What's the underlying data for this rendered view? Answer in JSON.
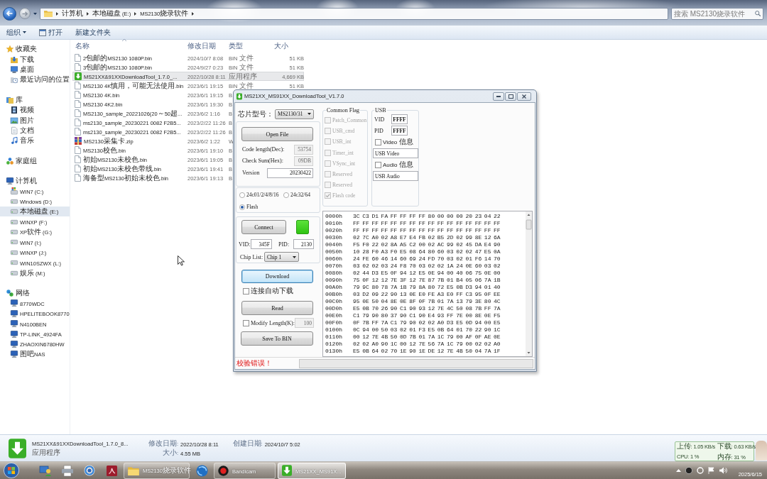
{
  "explorer": {
    "breadcrumbs": [
      {
        "label": "计算机"
      },
      {
        "label": "本地磁盘 (E:)"
      },
      {
        "label": "MS2130烧录软件"
      }
    ],
    "search": {
      "placeholder": "搜索 MS2130烧录软件"
    },
    "toolbar": [
      {
        "label": "组织",
        "kind": "menu"
      },
      {
        "label": "打开",
        "kind": "open"
      },
      {
        "label": "新建文件夹",
        "kind": "plain"
      }
    ],
    "sidebar": [
      {
        "label": "收藏夹",
        "kind": "favorites",
        "selected": false,
        "children": [
          {
            "label": "下载",
            "kind": "downloads",
            "selected": false
          },
          {
            "label": "桌面",
            "kind": "desktop",
            "selected": false
          },
          {
            "label": "最近访问的位置",
            "kind": "recent",
            "selected": false
          }
        ]
      },
      {
        "label": "库",
        "kind": "library",
        "selected": false,
        "children": [
          {
            "label": "视频",
            "kind": "video",
            "selected": false
          },
          {
            "label": "图片",
            "kind": "pictures",
            "selected": false
          },
          {
            "label": "文档",
            "kind": "documents",
            "selected": false
          },
          {
            "label": "音乐",
            "kind": "music",
            "selected": false
          }
        ]
      },
      {
        "label": "家庭组",
        "kind": "homegroup",
        "selected": false
      },
      {
        "label": "计算机",
        "kind": "computer",
        "selected": false,
        "children": [
          {
            "label": "WIN7 (C:)",
            "kind": "system-drive",
            "selected": false
          },
          {
            "label": "Windows (D:)",
            "kind": "drive",
            "selected": false
          },
          {
            "label": "本地磁盘 (E:)",
            "kind": "drive",
            "selected": true
          },
          {
            "label": "WINXP (F:)",
            "kind": "drive",
            "selected": false
          },
          {
            "label": "XP软件 (G:)",
            "kind": "drive",
            "selected": false
          },
          {
            "label": "WIN7 (I:)",
            "kind": "drive",
            "selected": false
          },
          {
            "label": "WINXP (J:)",
            "kind": "drive",
            "selected": false
          },
          {
            "label": "WIN10SZWX (L:)",
            "kind": "drive",
            "selected": false
          },
          {
            "label": "娱乐 (M:)",
            "kind": "drive",
            "selected": false
          }
        ]
      },
      {
        "label": "网络",
        "kind": "network",
        "selected": false,
        "children": [
          {
            "label": "8770WDC",
            "kind": "pc",
            "selected": false
          },
          {
            "label": "HPELITEBOOK8770",
            "kind": "pc",
            "selected": false
          },
          {
            "label": "N4100BEN",
            "kind": "pc",
            "selected": false
          },
          {
            "label": "TP-LINK_4924FA",
            "kind": "pc",
            "selected": false
          },
          {
            "label": "ZHAOXIN6780HW",
            "kind": "pc",
            "selected": false
          },
          {
            "label": "图吧NAS",
            "kind": "pc",
            "selected": false
          }
        ]
      }
    ],
    "columns": [
      "名称",
      "修改日期",
      "类型",
      "大小"
    ],
    "files": [
      {
        "name": "2包邮的MS2130 1080P.bin",
        "date": "2024/10/7 8:08",
        "type": "BIN 文件",
        "size": "51 KB",
        "kind": "bin",
        "selected": false
      },
      {
        "name": "3包邮的MS2130 1080P.bin",
        "date": "2024/9/27 0:23",
        "type": "BIN 文件",
        "size": "51 KB",
        "kind": "bin",
        "selected": false
      },
      {
        "name": "MS21XX&91XXDownloadTool_1.7.0_...",
        "date": "2022/10/28 8:11",
        "type": "应用程序",
        "size": "4,669 KB",
        "kind": "app",
        "selected": true
      },
      {
        "name": "MS2130 4K慎用，可能无法使用.bin",
        "date": "2023/6/1 19:15",
        "type": "BIN 文件",
        "size": "51 KB",
        "kind": "bin",
        "selected": false
      },
      {
        "name": "MS2130 4K.bin",
        "date": "2023/6/1 19:15",
        "type": "B",
        "kind": "bin",
        "selected": false
      },
      {
        "name": "MS2130 4K2.bin",
        "date": "2023/6/1 19:30",
        "type": "B",
        "kind": "bin",
        "selected": false
      },
      {
        "name": "MS2130_sample_20221026(20～50超...",
        "date": "2023/6/2 1:16",
        "type": "B",
        "kind": "bin",
        "selected": false
      },
      {
        "name": "ms2130_sample_20230221 0082 F2B5...",
        "date": "2023/2/22 11:26",
        "type": "B",
        "kind": "bin",
        "selected": false
      },
      {
        "name": "ms2130_sample_20230221 0082 F2B5...",
        "date": "2023/2/22 11:26",
        "type": "B",
        "kind": "bin",
        "selected": false
      },
      {
        "name": "MS2130采集卡.zip",
        "date": "2023/6/2 1:22",
        "type": "W",
        "kind": "zip",
        "selected": false
      },
      {
        "name": "MS2130校色.bin",
        "date": "2023/6/1 19:10",
        "type": "B",
        "kind": "bin",
        "selected": false
      },
      {
        "name": "初始MS2130未校色.bin",
        "date": "2023/6/1 19:05",
        "type": "B",
        "kind": "bin",
        "selected": false
      },
      {
        "name": "初始MS2130未校色带线.bin",
        "date": "2023/6/1 19:41",
        "type": "B",
        "kind": "bin",
        "selected": false
      },
      {
        "name": "海备型MS2130初始未校色.bin",
        "date": "2023/6/1 19:13",
        "type": "B",
        "kind": "bin",
        "selected": false
      }
    ],
    "details": {
      "name": "MS21XX&91XXDownloadTool_1.7.0_8...",
      "type": "应用程序",
      "fields": [
        {
          "label": "修改日期:",
          "value": "2022/10/28 8:11"
        },
        {
          "label": "大小:",
          "value": "4.55 MB"
        },
        {
          "label": "创建日期:",
          "value": "2024/10/7 5:02"
        }
      ]
    }
  },
  "tool_window": {
    "title": "MS21XX_MS91XX_DownloadTool_V1.7.0",
    "chip_model": {
      "label": "芯片型号：",
      "value": "MS2130/31"
    },
    "open_file_button": "Open File",
    "code_info": [
      {
        "label": "Code length(Dec):",
        "value": "53754",
        "disabled": true
      },
      {
        "label": "Check Sum(Hex):",
        "value": "09DB",
        "disabled": true
      },
      {
        "label": "Version",
        "value": "20230422",
        "disabled": false
      }
    ],
    "memory_type": [
      {
        "label": "24c01/2/4/8/16",
        "selected": false
      },
      {
        "label": "24c32/64",
        "selected": false
      },
      {
        "label": "Flash",
        "selected": true
      }
    ],
    "connect_button": "Connect",
    "connection": {
      "connected": true
    },
    "vid": {
      "label": "VID:",
      "value": "345F"
    },
    "pid": {
      "label": "PID:",
      "value": "2130"
    },
    "chip_list": {
      "label": "Chip List:",
      "value": "Chip 1"
    },
    "download_button": {
      "label": "Download",
      "focused": true
    },
    "auto_download": {
      "label": "连接自动下载",
      "checked": false
    },
    "read_button": "Read",
    "modify_length": {
      "label": "Modify Length(K):",
      "checked": false,
      "value": "100"
    },
    "save_button": "Save To BIN",
    "common_flag": {
      "title": "Common Flag",
      "flags": [
        {
          "label": "Patch_Common",
          "checked": false,
          "disabled": true
        },
        {
          "label": "USB_cmd",
          "checked": false,
          "disabled": true
        },
        {
          "label": "USB_int",
          "checked": false,
          "disabled": true
        },
        {
          "label": "Timer_int",
          "checked": false,
          "disabled": true
        },
        {
          "label": "VSync_int",
          "checked": false,
          "disabled": true
        },
        {
          "label": "Reserved",
          "checked": false,
          "disabled": true
        },
        {
          "label": "Reserved",
          "checked": false,
          "disabled": true
        },
        {
          "label": "Flash code",
          "checked": true,
          "disabled": true
        }
      ]
    },
    "usb": {
      "title": "USB",
      "vid": {
        "label": "VID",
        "value": "FFFF"
      },
      "pid": {
        "label": "PID",
        "value": "FFFF"
      },
      "video": {
        "label": "Video 信息",
        "checked": false,
        "value": "USB Video"
      },
      "audio": {
        "label": "Audio 信息",
        "checked": false,
        "value": "USB Audio"
      }
    },
    "hex_dump": [
      {
        "offset": "0000h",
        "bytes": "3C C3 D1 FA FF FF FF FF 80 00 00 00 20 23 04 22"
      },
      {
        "offset": "0010h",
        "bytes": "FF FF FF FF FF FF FF FF FF FF FF FF FF FF FF FF"
      },
      {
        "offset": "0020h",
        "bytes": "FF FF FF FF FF FF FF FF FF FF FF FF FF FF FF FF"
      },
      {
        "offset": "0030h",
        "bytes": "02 7C A0 02 A8 E7 E4 FB 02 B5 2D 02 99 8E 12 6A"
      },
      {
        "offset": "0040h",
        "bytes": "F5 F0 22 02 8A A5 C2 00 02 AC 99 02 45 DA E4 90"
      },
      {
        "offset": "0050h",
        "bytes": "10 28 F0 A3 F0 E5 08 64 80 60 03 02 02 47 E5 0A"
      },
      {
        "offset": "0060h",
        "bytes": "24 FE 60 46 14 60 69 24 FD 70 03 02 01 F6 14 70"
      },
      {
        "offset": "0070h",
        "bytes": "03 02 02 03 24 F8 70 03 02 02 1A 24 0E 60 03 02"
      },
      {
        "offset": "0080h",
        "bytes": "02 44 D3 E5 0F 94 12 E5 0E 94 00 40 06 75 0E 00"
      },
      {
        "offset": "0090h",
        "bytes": "75 0F 12 12 7E 3F 12 7E 87 7B 01 B4 05 06 7A 1B"
      },
      {
        "offset": "00A0h",
        "bytes": "79 9C 80 78 7A 1B 79 8A 80 72 E5 0B D3 94 01 40"
      },
      {
        "offset": "00B0h",
        "bytes": "03 D2 09 22 90 13 0E E0 FE A3 E0 FF C3 95 0F EE"
      },
      {
        "offset": "00C0h",
        "bytes": "95 0E 50 04 8E 0E 8F 0F 7B 01 7A 13 79 3E 80 4C"
      },
      {
        "offset": "00D0h",
        "bytes": "E5 0B 70 26 90 C1 90 93 12 7E 4C 50 08 7B FF 7A"
      },
      {
        "offset": "00E0h",
        "bytes": "C1 79 90 80 37 90 C1 90 E4 93 FF 7E 00 8E 0E F5"
      },
      {
        "offset": "00F0h",
        "bytes": "0F 7B FF 7A C1 79 90 02 02 A0 D3 E5 0D 94 00 E5"
      },
      {
        "offset": "0100h",
        "bytes": "0C 94 00 50 03 02 01 F3 E5 0B 64 01 70 22 90 1C"
      },
      {
        "offset": "0110h",
        "bytes": "00 12 7E 4B 50 0D 7B 01 7A 1C 79 00 AF 0F AE 0E"
      },
      {
        "offset": "0120h",
        "bytes": "02 02 A0 90 1C 00 12 7E 56 7A 1C 79 00 02 02 A0"
      },
      {
        "offset": "0130h",
        "bytes": "E5 0B 64 02 70 1E 90 1E DE 12 7E 4B 50 04 7A 1F"
      }
    ],
    "status": {
      "text": "校验错误！",
      "kind": "error"
    }
  },
  "taskbar": {
    "windows": [
      {
        "label": "MS2130烧录软件",
        "kind": "folder",
        "selected": false
      },
      {
        "label": "Bandicam",
        "kind": "recorder",
        "selected": false
      },
      {
        "label": "MS21XX_MS91X...",
        "kind": "download-tool",
        "selected": true
      }
    ],
    "date": "2025/6/15"
  },
  "net_monitor": {
    "rows": [
      [
        "上传: 1.05 KB/s",
        "下载: 0.63 KB/s"
      ],
      [
        "CPU: 1 %",
        "内存: 31 %"
      ]
    ]
  }
}
